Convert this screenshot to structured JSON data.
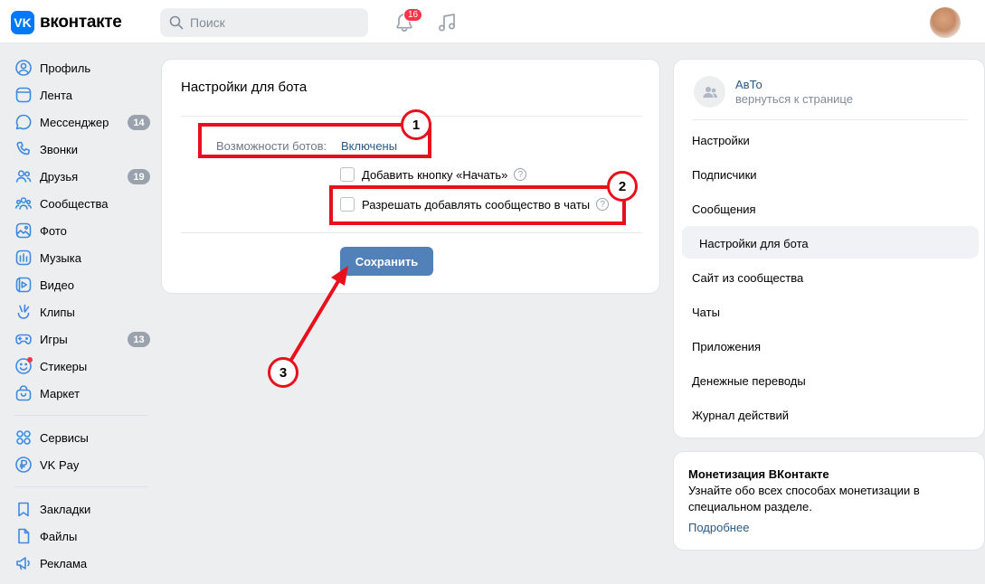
{
  "header": {
    "logo_mark": "VK",
    "logo_text": "вконтакте",
    "search_placeholder": "Поиск",
    "notifications_count": "16"
  },
  "leftnav": {
    "items": [
      {
        "label": "Профиль",
        "icon": "profile-icon"
      },
      {
        "label": "Лента",
        "icon": "feed-icon"
      },
      {
        "label": "Мессенджер",
        "icon": "messenger-icon",
        "badge": "14"
      },
      {
        "label": "Звонки",
        "icon": "phone-icon"
      },
      {
        "label": "Друзья",
        "icon": "friends-icon",
        "badge": "19"
      },
      {
        "label": "Сообщества",
        "icon": "communities-icon"
      },
      {
        "label": "Фото",
        "icon": "photo-icon"
      },
      {
        "label": "Музыка",
        "icon": "music-icon"
      },
      {
        "label": "Видео",
        "icon": "video-icon"
      },
      {
        "label": "Клипы",
        "icon": "clips-icon"
      },
      {
        "label": "Игры",
        "icon": "games-icon",
        "badge": "13"
      },
      {
        "label": "Стикеры",
        "icon": "stickers-icon"
      },
      {
        "label": "Маркет",
        "icon": "market-icon"
      }
    ],
    "items2": [
      {
        "label": "Сервисы",
        "icon": "services-icon"
      },
      {
        "label": "VK Pay",
        "icon": "vkpay-icon"
      }
    ],
    "items3": [
      {
        "label": "Закладки",
        "icon": "bookmarks-icon"
      },
      {
        "label": "Файлы",
        "icon": "files-icon"
      },
      {
        "label": "Реклама",
        "icon": "ads-icon"
      }
    ]
  },
  "main": {
    "title": "Настройки для бота",
    "caps_label": "Возможности ботов:",
    "caps_value": "Включены",
    "checkbox_start": "Добавить кнопку «Начать»",
    "checkbox_chats": "Разрешать добавлять сообщество в чаты",
    "help_glyph": "?",
    "save_label": "Сохранить"
  },
  "right": {
    "group_name": "АвТо",
    "group_back": "вернуться к странице",
    "menu": [
      "Настройки",
      "Подписчики",
      "Сообщения",
      "Настройки для бота",
      "Сайт из сообщества",
      "Чаты",
      "Приложения",
      "Денежные переводы",
      "Журнал действий"
    ],
    "active_index": 3
  },
  "promo": {
    "title": "Монетизация ВКонтакте",
    "text": "Узнайте обо всех способах монетизации в специальном разделе.",
    "link": "Подробнее"
  },
  "annotations": [
    "1",
    "2",
    "3"
  ],
  "colors": {
    "accent": "#0077ff",
    "button": "#5181b8",
    "link": "#2a5885",
    "annotation": "#e8101c"
  }
}
